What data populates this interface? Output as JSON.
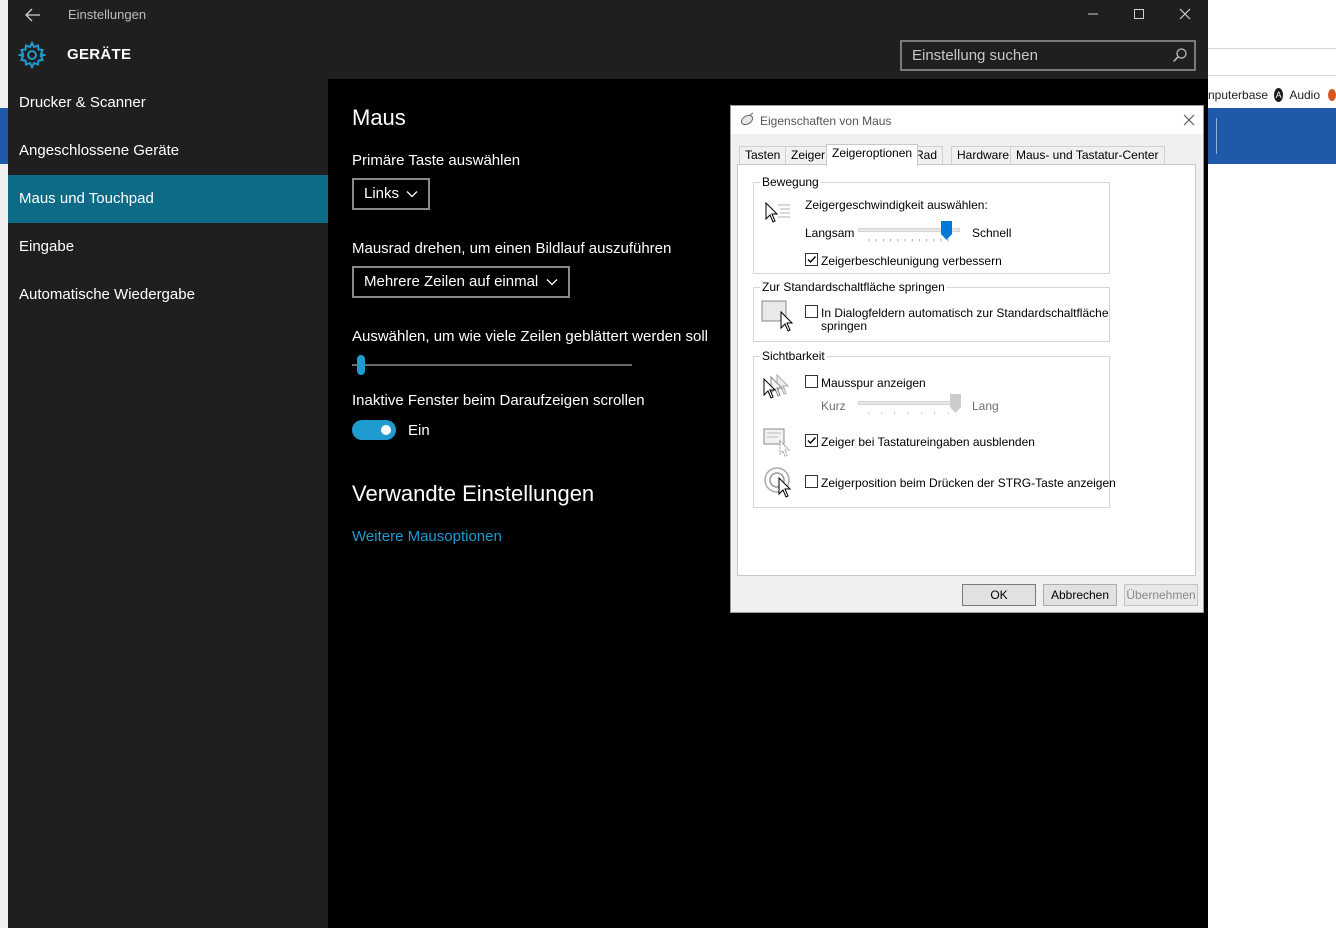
{
  "background": {
    "bookmarks": [
      {
        "label": "nputerbase"
      },
      {
        "label": "Audio",
        "icon": "A"
      }
    ]
  },
  "settings_window": {
    "title": "Einstellungen",
    "header": {
      "title": "GERÄTE",
      "icon": "gear-icon"
    },
    "search": {
      "placeholder": "Einstellung suchen"
    },
    "sidebar": {
      "items": [
        {
          "label": "Drucker & Scanner",
          "active": false
        },
        {
          "label": "Angeschlossene Geräte",
          "active": false
        },
        {
          "label": "Maus und Touchpad",
          "active": true
        },
        {
          "label": "Eingabe",
          "active": false
        },
        {
          "label": "Automatische Wiedergabe",
          "active": false
        }
      ]
    },
    "content": {
      "heading": "Maus",
      "primary_button_label": "Primäre Taste auswählen",
      "primary_button_value": "Links",
      "wheel_label": "Mausrad drehen, um einen Bildlauf auszuführen",
      "wheel_value": "Mehrere Zeilen auf einmal",
      "lines_label": "Auswählen, um wie viele Zeilen geblättert werden soll",
      "lines_slider_fraction": 0.03,
      "inactive_scroll_label": "Inaktive Fenster beim Daraufzeigen scrollen",
      "inactive_scroll_state": "Ein",
      "related_heading": "Verwandte Einstellungen",
      "more_mouse_options_link": "Weitere Mausoptionen"
    },
    "accent_color": "#1f9bd0",
    "active_nav_color": "#0e6b87"
  },
  "mouse_dialog": {
    "title": "Eigenschaften von Maus",
    "tabs": [
      {
        "label": "Tasten",
        "active": false
      },
      {
        "label": "Zeiger",
        "active": false
      },
      {
        "label": "Zeigeroptionen",
        "active": true
      },
      {
        "label": "Rad",
        "active": false
      },
      {
        "label": "Hardware",
        "active": false
      },
      {
        "label": "Maus- und Tastatur-Center",
        "active": false
      }
    ],
    "motion": {
      "legend": "Bewegung",
      "speed_label": "Zeigergeschwindigkeit auswählen:",
      "slow": "Langsam",
      "fast": "Schnell",
      "speed_fraction": 0.85,
      "precision_label": "Zeigerbeschleunigung verbessern",
      "precision_checked": true
    },
    "snap_to": {
      "legend": "Zur Standardschaltfläche springen",
      "label_line1": "In Dialogfeldern automatisch zur Standardschaltfläche",
      "label_line2": "springen",
      "checked": false
    },
    "visibility": {
      "legend": "Sichtbarkeit",
      "trails_label": "Mausspur anzeigen",
      "trails_checked": false,
      "short": "Kurz",
      "long": "Lang",
      "trails_fraction": 1.0,
      "hide_label": "Zeiger bei Tastatureingaben ausblenden",
      "hide_checked": true,
      "ctrl_label": "Zeigerposition beim Drücken der STRG-Taste anzeigen",
      "ctrl_checked": false
    },
    "buttons": {
      "ok": "OK",
      "cancel": "Abbrechen",
      "apply": "Übernehmen"
    }
  }
}
